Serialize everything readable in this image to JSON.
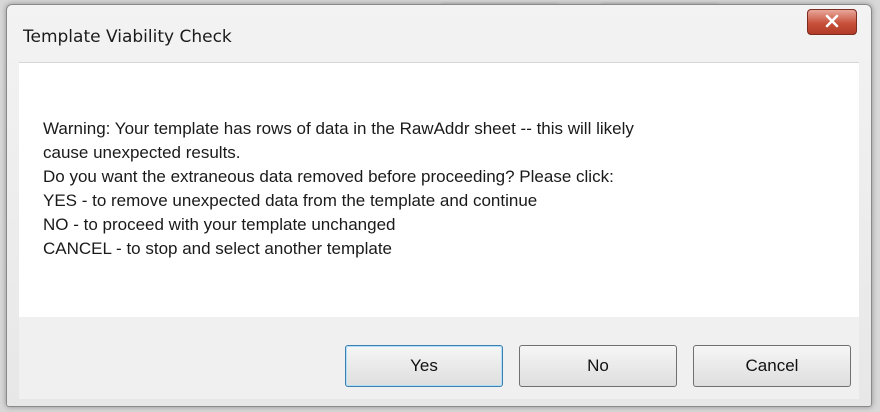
{
  "dialog": {
    "title": "Template Viability Check",
    "close_icon": "close-icon",
    "message_lines": [
      "Warning: Your template has rows of data in the RawAddr sheet -- this will likely",
      "cause unexpected results.",
      "Do you want the extraneous data removed before proceeding?  Please click:",
      "YES - to remove unexpected data from the template and continue",
      "NO - to proceed with your template unchanged",
      "CANCEL - to stop and select another template"
    ],
    "buttons": {
      "yes": "Yes",
      "no": "No",
      "cancel": "Cancel"
    }
  },
  "colors": {
    "close_button": "#c8513b",
    "content_background": "#ffffff",
    "footer_background": "#f0f0f0"
  }
}
